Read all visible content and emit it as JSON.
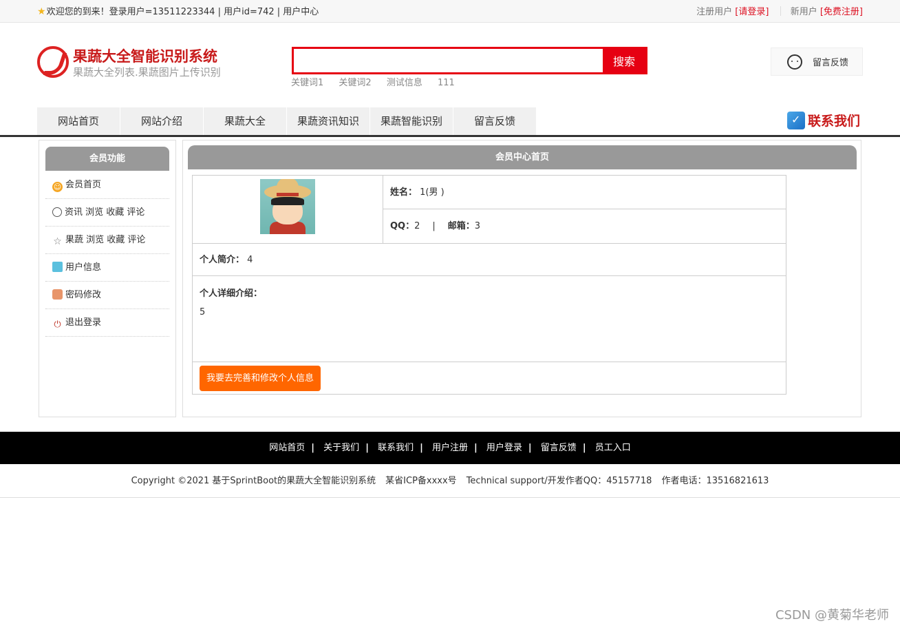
{
  "topbar": {
    "welcome": "欢迎您的到来！登录用户=13511223344 | 用户id=742 | 用户中心",
    "registered_label": "注册用户",
    "login_link": "[请登录]",
    "new_user_label": "新用户",
    "register_link": "[免费注册]"
  },
  "header": {
    "title": "果蔬大全智能识别系统",
    "subtitle": "果蔬大全列表.果蔬图片上传识别",
    "search_placeholder": "",
    "search_button": "搜索",
    "hot_words": [
      "关键词1",
      "关键词2",
      "测试信息",
      "111"
    ],
    "feedback_button": "留言反馈",
    "contact_label": "联系我们"
  },
  "nav": {
    "items": [
      "网站首页",
      "网站介绍",
      "果蔬大全",
      "果蔬资讯知识",
      "果蔬智能识别",
      "留言反馈"
    ]
  },
  "sidebar": {
    "title": "会员功能",
    "items": [
      {
        "label": "会员首页",
        "icon": "home-icon"
      },
      {
        "label": "资讯 浏览 收藏 评论",
        "icon": "clock-icon"
      },
      {
        "label": "果蔬 浏览 收藏 评论",
        "icon": "star-icon"
      },
      {
        "label": "用户信息",
        "icon": "user-info-icon"
      },
      {
        "label": "密码修改",
        "icon": "lock-icon"
      },
      {
        "label": "退出登录",
        "icon": "power-icon"
      }
    ]
  },
  "main": {
    "title": "会员中心首页",
    "name_label": "姓名：",
    "name_value": "1(男 )",
    "qq_label": "QQ：",
    "qq_value": "2",
    "divider": "|",
    "email_label": "邮箱：",
    "email_value": "3",
    "intro_label": "个人简介：",
    "intro_value": "4",
    "detail_label": "个人详细介绍：",
    "detail_value": "5",
    "edit_button": "我要去完善和修改个人信息"
  },
  "footer": {
    "links": [
      "网站首页",
      "关于我们",
      "联系我们",
      "用户注册",
      "用户登录",
      "留言反馈",
      "员工入口"
    ],
    "separator": "|",
    "copyright": "Copyright ©2021 基于SprintBoot的果蔬大全智能识别系统",
    "icp": "某省ICP备xxxx号",
    "support": "Technical support/开发作者QQ：45157718",
    "phone": "作者电话：13516821613"
  },
  "watermark": "CSDN @黄菊华老师",
  "colors": {
    "brand_red": "#e60012",
    "title_red": "#c81a1a",
    "button_orange": "#ff6600",
    "panel_gray": "#999999"
  }
}
